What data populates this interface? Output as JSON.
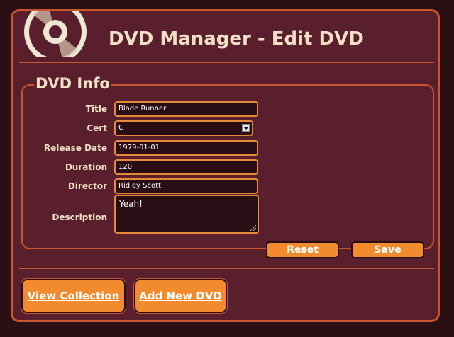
{
  "header": {
    "title": "DVD Manager - Edit DVD",
    "logo_icon": "disc-icon"
  },
  "form": {
    "legend": "DVD Info",
    "fields": {
      "title": {
        "label": "Title",
        "value": "Blade Runner"
      },
      "cert": {
        "label": "Cert",
        "value": "G"
      },
      "release_date": {
        "label": "Release Date",
        "value": "1979-01-01"
      },
      "duration": {
        "label": "Duration",
        "value": "120"
      },
      "director": {
        "label": "Director",
        "value": "Ridley Scott"
      },
      "description": {
        "label": "Description",
        "value": "Yeah!"
      }
    },
    "reset_label": "Reset",
    "save_label": "Save"
  },
  "nav": {
    "view_collection": "View Collection",
    "add_new": "Add New DVD"
  },
  "colors": {
    "background": "#2a0f14",
    "panel": "#5a1f2c",
    "accent": "#c9562e",
    "button": "#f28a2e",
    "text": "#f2dfc5"
  }
}
